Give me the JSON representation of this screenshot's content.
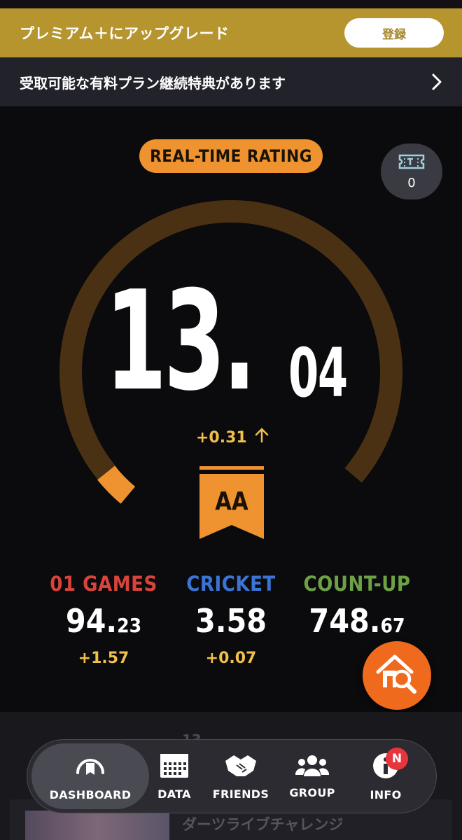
{
  "premium_banner": {
    "title": "プレミアム＋にアップグレード",
    "register_label": "登録"
  },
  "benefit_banner": {
    "text": "受取可能な有料プラン継続特典があります"
  },
  "rating": {
    "pill_label": "REAL-TIME RATING",
    "integer_part": "13.",
    "decimal_part": "04",
    "delta": "+0.31",
    "grade": "AA",
    "gauge_progress": 0.04
  },
  "ticket": {
    "count": "0",
    "icon": "ticket-icon"
  },
  "stats": [
    {
      "title": "01 GAMES",
      "value_main": "94.",
      "value_small": "23",
      "delta": "+1.57",
      "color": "#d8443c"
    },
    {
      "title": "CRICKET",
      "value_main": "3.58",
      "value_small": "",
      "delta": "+0.07",
      "color": "#3a74d4"
    },
    {
      "title": "COUNT-UP",
      "value_main": "748.",
      "value_small": "67",
      "delta": "",
      "color": "#6ca244"
    }
  ],
  "background_content": {
    "faded_number": "13",
    "card_title": "ダーツライブチャレンジ"
  },
  "tabbar": {
    "tabs": [
      {
        "label": "DASHBOARD",
        "icon": "dashboard-icon"
      },
      {
        "label": "DATA",
        "icon": "data-calendar-icon"
      },
      {
        "label": "FRIENDS",
        "icon": "friends-handshake-icon"
      },
      {
        "label": "GROUP",
        "icon": "group-icon"
      },
      {
        "label": "INFO",
        "icon": "info-icon",
        "badge": "N"
      }
    ]
  },
  "colors": {
    "accent": "#ee9330",
    "gold": "#b6952f",
    "fab": "#f06a1e",
    "delta": "#f0c04a"
  }
}
